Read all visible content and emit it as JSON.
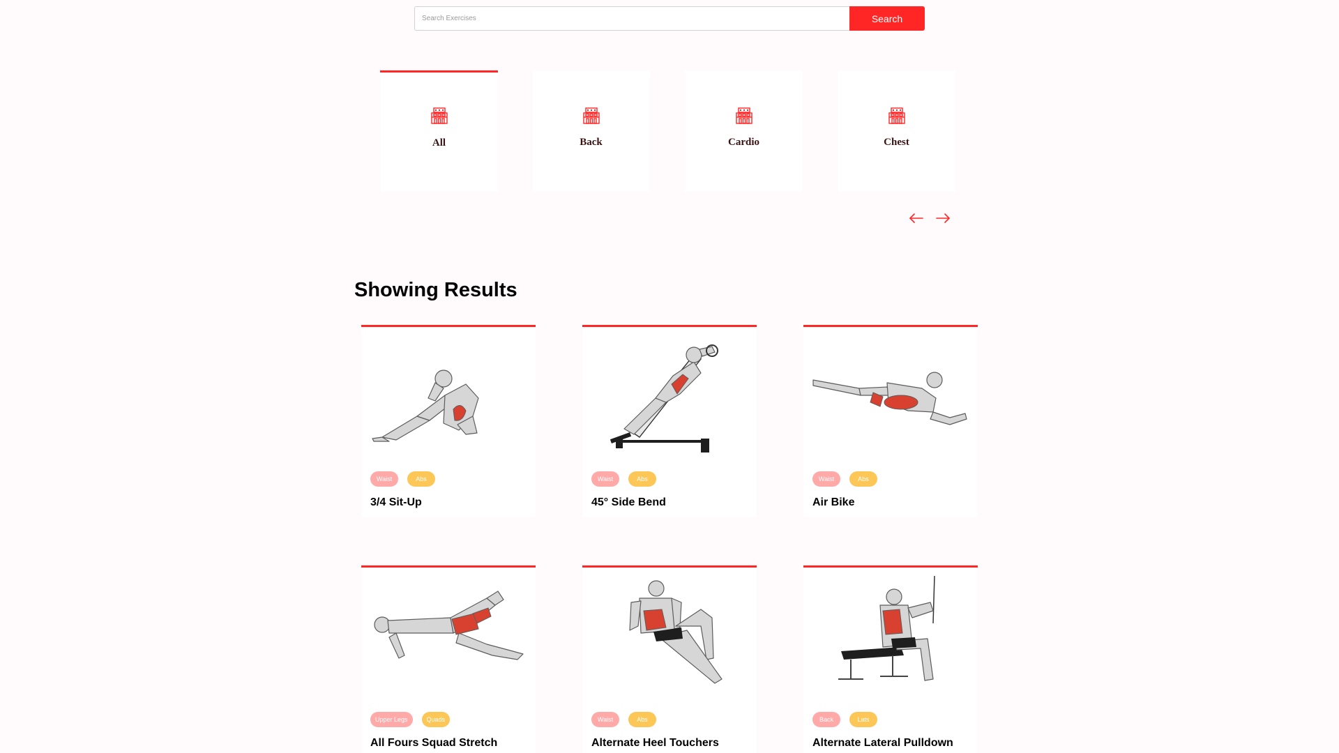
{
  "search": {
    "placeholder": "Search Exercises",
    "value": "",
    "button_label": "Search"
  },
  "categories": [
    {
      "label": "All",
      "active": true,
      "icon": "gym-icon"
    },
    {
      "label": "Back",
      "active": false,
      "icon": "gym-icon"
    },
    {
      "label": "Cardio",
      "active": false,
      "icon": "gym-icon"
    },
    {
      "label": "Chest",
      "active": false,
      "icon": "gym-icon"
    }
  ],
  "carousel": {
    "prev_icon": "left-arrow-icon",
    "next_icon": "right-arrow-icon"
  },
  "results": {
    "title": "Showing Results",
    "exercises": [
      {
        "name": "3/4 Sit-Up",
        "body_part": "Waist",
        "target": "Abs",
        "image": "sit-up-illustration"
      },
      {
        "name": "45° Side Bend",
        "body_part": "Waist",
        "target": "Abs",
        "image": "side-bend-illustration"
      },
      {
        "name": "Air Bike",
        "body_part": "Waist",
        "target": "Abs",
        "image": "air-bike-illustration"
      },
      {
        "name": "All Fours Squad Stretch",
        "body_part": "Upper Legs",
        "target": "Quads",
        "image": "quad-stretch-illustration"
      },
      {
        "name": "Alternate Heel Touchers",
        "body_part": "Waist",
        "target": "Abs",
        "image": "heel-touchers-illustration"
      },
      {
        "name": "Alternate Lateral Pulldown",
        "body_part": "Back",
        "target": "Lats",
        "image": "lateral-pulldown-illustration"
      }
    ]
  },
  "colors": {
    "accent": "#ff2625",
    "page_background": "#fffafb",
    "body_part_tag": "#ffa9a9",
    "target_tag": "#fcc757",
    "muscle_highlight": "#d8412f"
  }
}
